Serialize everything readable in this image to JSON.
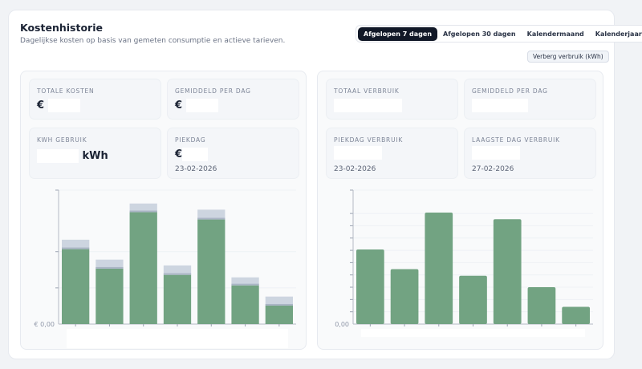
{
  "header": {
    "title": "Kostenhistorie",
    "subtitle": "Dagelijkse kosten op basis van gemeten consumptie en actieve tarieven."
  },
  "range_tabs": [
    {
      "label": "Afgelopen 7 dagen",
      "active": true
    },
    {
      "label": "Afgelopen 30 dagen",
      "active": false
    },
    {
      "label": "Kalendermaand",
      "active": false
    },
    {
      "label": "Kalenderjaar",
      "active": false
    }
  ],
  "toggle_usage_label": "Verberg verbruik (kWh)",
  "costs": {
    "total": {
      "label": "TOTALE KOSTEN",
      "prefix": "€"
    },
    "avg": {
      "label": "GEMIDDELD PER DAG",
      "prefix": "€"
    },
    "kwh": {
      "label": "KWH GEBRUIK",
      "unit": "kWh"
    },
    "peak": {
      "label": "PIEKDAG",
      "prefix": "€",
      "date": "23-02-2026"
    }
  },
  "usage": {
    "total": {
      "label": "TOTAAL VERBRUIK"
    },
    "avg": {
      "label": "GEMIDDELD PER DAG"
    },
    "peak": {
      "label": "PIEKDAG VERBRUIK",
      "date": "23-02-2026"
    },
    "low": {
      "label": "LAAGSTE DAG VERBRUIK",
      "date": "27-02-2026"
    }
  },
  "colors": {
    "bar": "#72a382",
    "bar_top": "#cdd5e0",
    "accent": "#111827"
  },
  "chart_data": [
    {
      "type": "bar",
      "stacked": true,
      "y_zero_label": "€ 0,00",
      "grid": true,
      "series": [
        {
          "values": [
            2.07,
            1.53,
            3.09,
            1.36,
            2.89,
            1.07,
            0.51
          ]
        },
        {
          "values": [
            0.26,
            0.25,
            0.24,
            0.26,
            0.27,
            0.22,
            0.25
          ]
        }
      ],
      "ylim": [
        0,
        3.7
      ]
    },
    {
      "type": "bar",
      "y_zero_label": "0,00",
      "grid": true,
      "values": [
        6.07,
        4.47,
        9.07,
        3.93,
        8.53,
        3.0,
        1.4
      ],
      "ylim": [
        0,
        10.9
      ]
    }
  ]
}
